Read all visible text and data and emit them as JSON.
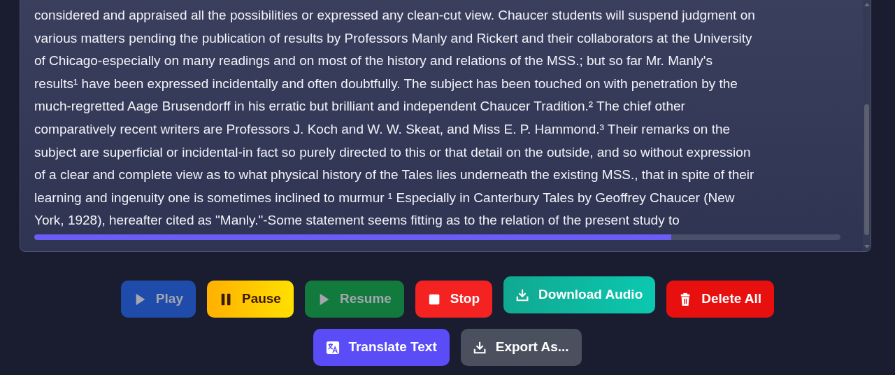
{
  "reader": {
    "lines": [
      "considered and appraised all the possibilities or expressed any clean-cut view. Chaucer students will suspend judgment on",
      "various matters pending the publication of results by Professors Manly and Rickert and their collaborators at the University",
      "of Chicago-especially on many readings and on most of the history and relations of the MSS.; but so far Mr. Manly's",
      "results¹ have been expressed incidentally and often doubtfully. The subject has been touched on with penetration by the",
      "much-regretted Aage Brusendorff in his erratic but brilliant and independent Chaucer Tradition.² The chief other",
      "comparatively recent writers are Professors J. Koch and W. W. Skeat, and Miss E. P. Hammond.³ Their remarks on the",
      "subject are superficial or incidental-in fact so purely directed to this or that detail on the outside, and so without expression",
      "of a clear and complete view as to what physical history of the Tales lies underneath the existing MSS., that in spite of their",
      "learning and ingenuity one is sometimes inclined to murmur ¹ Especially in Canterbury Tales by Geoffrey Chaucer (New",
      "York, 1928), hereafter cited as \"Manly.\"-Some statement seems fitting as to the relation of the present study to"
    ],
    "progress": {
      "level": 0.79
    }
  },
  "controls": [
    [
      {
        "label": "Play",
        "kind": "play",
        "disabled": true
      },
      {
        "label": "Pause",
        "kind": "pause",
        "disabled": false
      },
      {
        "label": "Resume",
        "kind": "resume",
        "disabled": true
      },
      {
        "label": "Stop",
        "kind": "stop",
        "disabled": false
      },
      {
        "label": "Download Audio",
        "kind": "download",
        "disabled": false
      },
      {
        "label": "Delete All",
        "kind": "delete",
        "disabled": false
      }
    ],
    [
      {
        "label": "Translate Text",
        "kind": "translate",
        "disabled": false
      },
      {
        "label": "Export As...",
        "kind": "export",
        "disabled": false
      }
    ]
  ]
}
